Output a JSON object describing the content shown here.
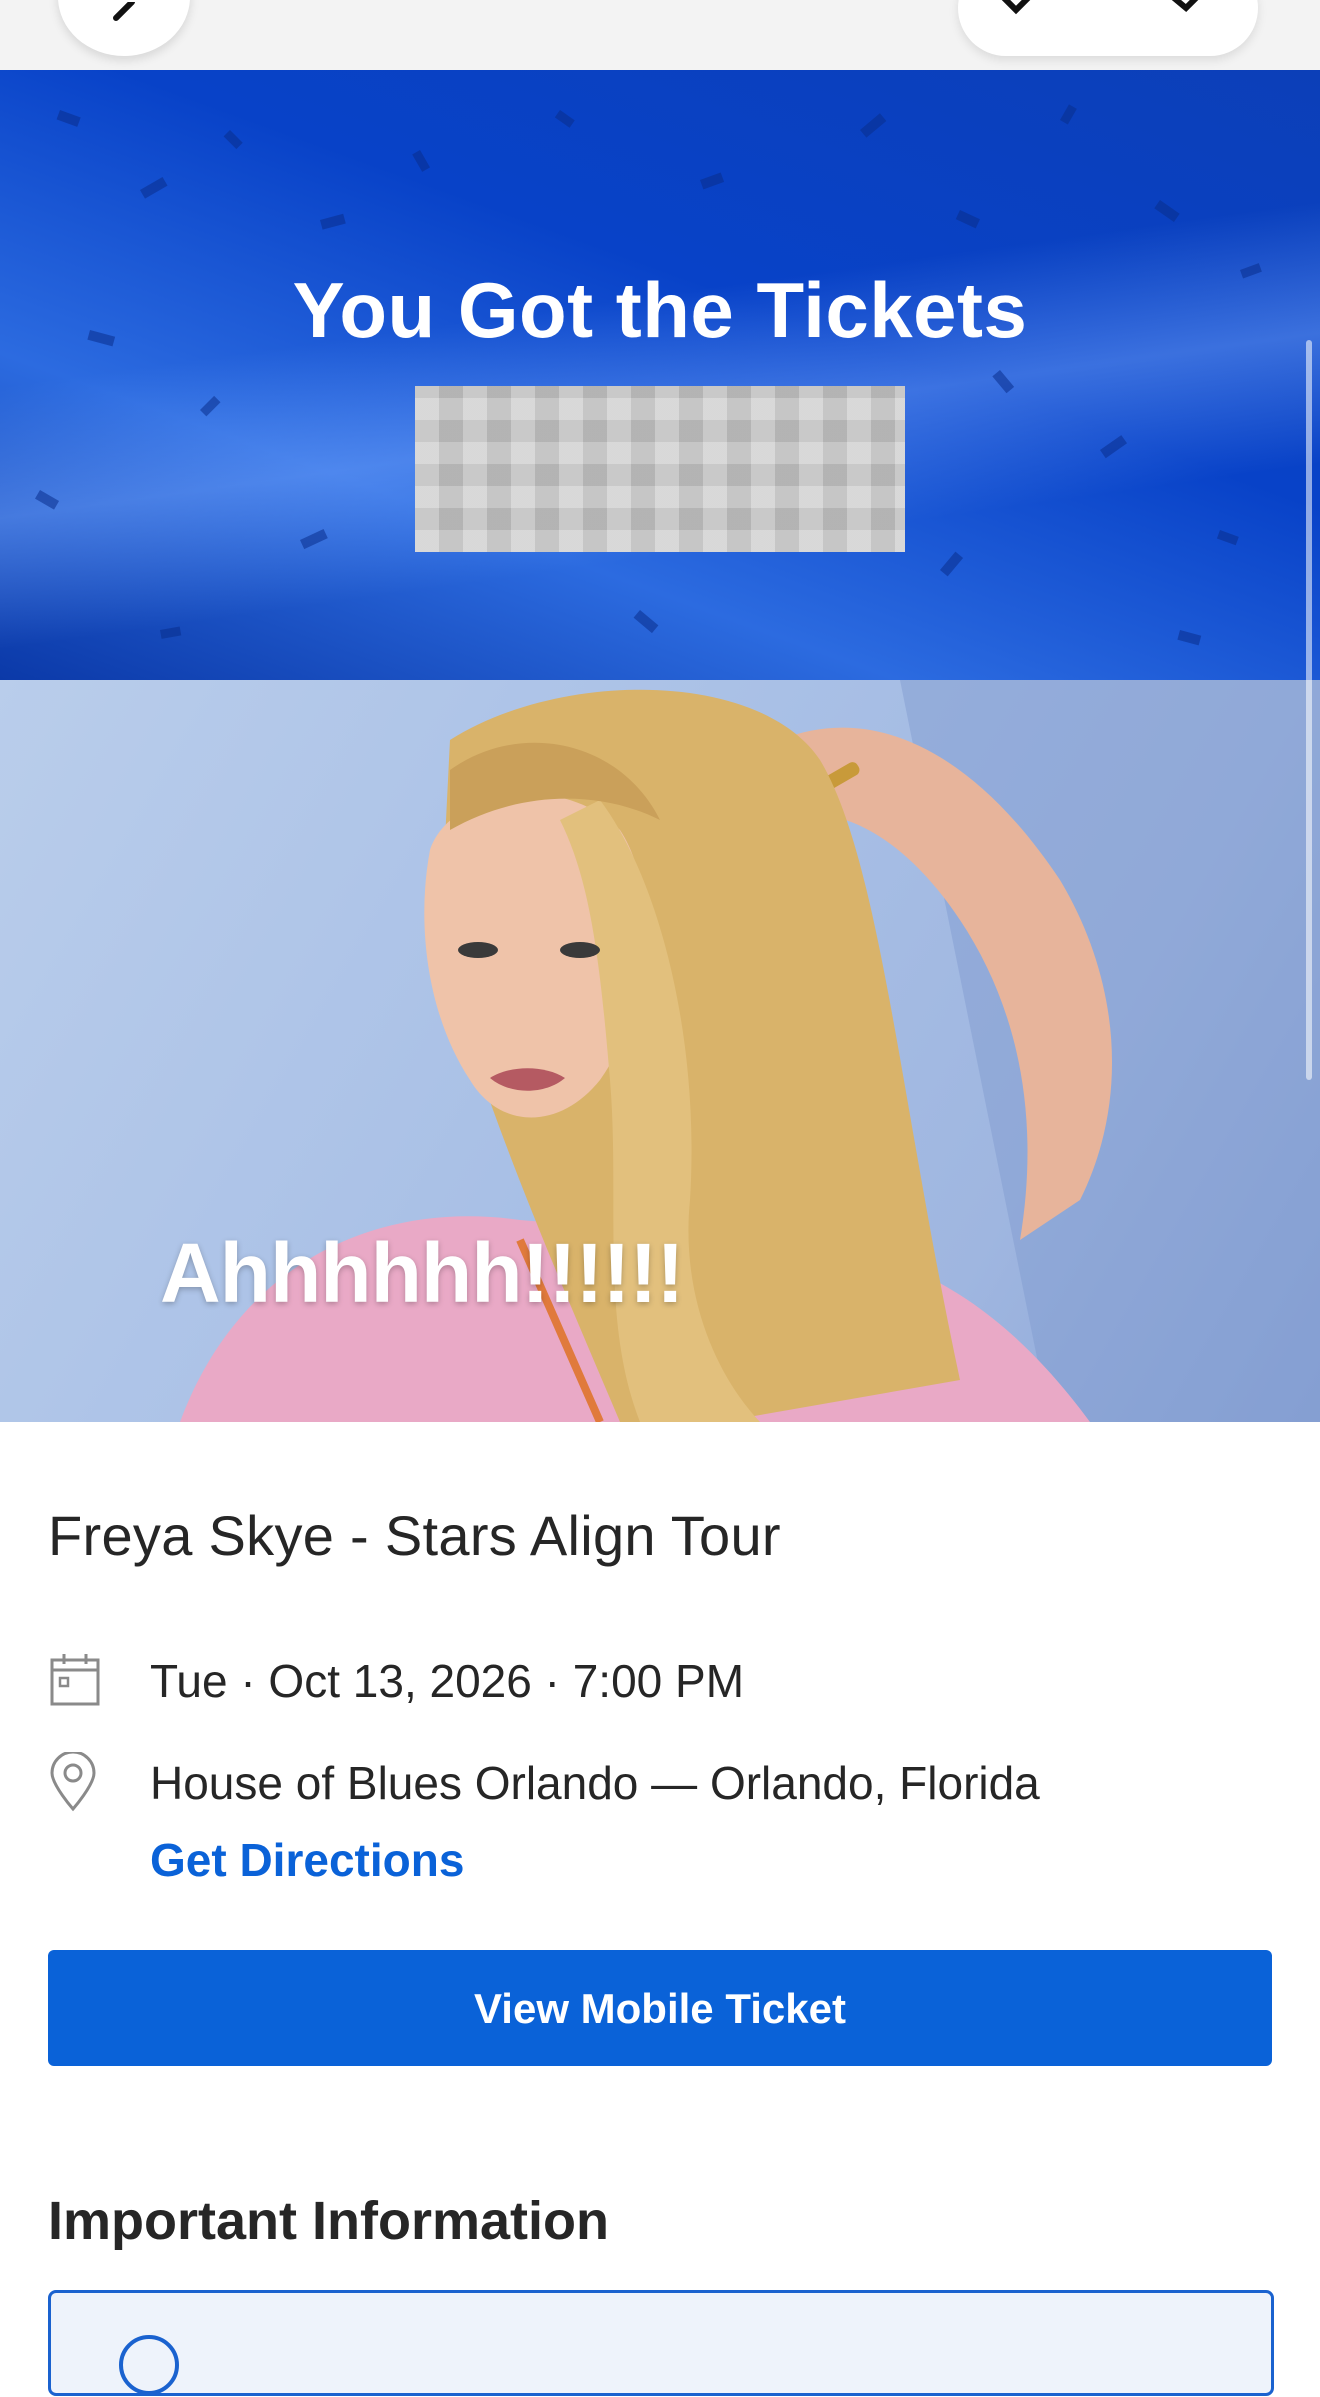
{
  "hero": {
    "title": "You Got the Tickets"
  },
  "artist_image": {
    "caption": "Ahhhhhh!!!!!!"
  },
  "event": {
    "title": "Freya Skye - Stars Align Tour",
    "datetime": "Tue · Oct 13, 2026 · 7:00 PM",
    "venue": "House of Blues Orlando — Orlando, Florida",
    "directions_label": "Get Directions"
  },
  "actions": {
    "view_ticket_label": "View Mobile Ticket"
  },
  "important": {
    "title": "Important Information"
  },
  "icons": {
    "back": "chevron-left-icon",
    "close": "close-icon",
    "check": "check-icon",
    "calendar": "calendar-icon",
    "location": "map-pin-icon",
    "info": "info-icon"
  },
  "colors": {
    "brand_blue": "#0a62d8",
    "hero_blue": "#0842c8",
    "text": "#262626"
  }
}
